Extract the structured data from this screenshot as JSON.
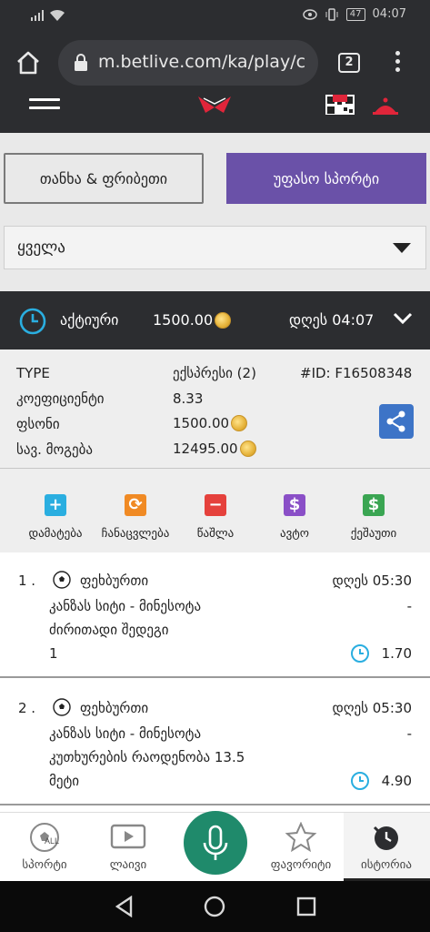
{
  "status_bar": {
    "time": "04:07",
    "battery": "47"
  },
  "browser": {
    "url": "m.betlive.com/ka/play/c",
    "tab_count": "2"
  },
  "tabs": {
    "left_label": "თანხა & ფრიბეთი",
    "right_label": "უფასო სპორტი"
  },
  "filter": {
    "selected": "ყველა"
  },
  "bet_summary": {
    "status": "აქტიური",
    "amount": "1500.00",
    "time": "დღეს 04:07"
  },
  "details": {
    "type_label": "TYPE",
    "type_value": "ექსპრესი (2)",
    "id": "#ID: F16508348",
    "odds_label": "კოეფიციენტი",
    "odds_value": "8.33",
    "stake_label": "ფსონი",
    "stake_value": "1500.00",
    "win_label": "სავ. მოგება",
    "win_value": "12495.00"
  },
  "actions": [
    {
      "label": "დამატება",
      "icon": "plus-icon",
      "color": "#2aaee0"
    },
    {
      "label": "ჩანაცვლება",
      "icon": "swap-icon",
      "color": "#f08a24"
    },
    {
      "label": "წაშლა",
      "icon": "minus-icon",
      "color": "#e5413c"
    },
    {
      "label": "ავტო",
      "icon": "dollar-icon",
      "color": "#8a4fc7"
    },
    {
      "label": "ქეშაუთი",
      "icon": "dollar-icon",
      "color": "#3aa552"
    }
  ],
  "bets": [
    {
      "num": "1 .",
      "sport": "ფეხბურთი",
      "time": "დღეს 05:30",
      "match": "კანზას სიტი - მინესოტა",
      "dash": "-",
      "market": "ძირითადი შედეგი",
      "pick": "1",
      "odd": "1.70"
    },
    {
      "num": "2 .",
      "sport": "ფეხბურთი",
      "time": "დღეს 05:30",
      "match": "კანზას სიტი - მინესოტა",
      "dash": "-",
      "market": "კუთხურების რაოდენობა 13.5",
      "pick": "მეტი",
      "odd": "4.90"
    }
  ],
  "bottom_nav": [
    {
      "label": "სპორტი",
      "icon": "soccer-all-icon"
    },
    {
      "label": "ლაივი",
      "icon": "play-icon"
    },
    {
      "label": "",
      "icon": "mic-icon"
    },
    {
      "label": "ფავორიტი",
      "icon": "star-icon"
    },
    {
      "label": "ისტორია",
      "icon": "history-icon"
    }
  ],
  "colors": {
    "dark_bar": "#2c2d30",
    "accent_purple": "#6a51a8",
    "clock_blue": "#2aaee0",
    "mic_green": "#1f8a6b"
  }
}
